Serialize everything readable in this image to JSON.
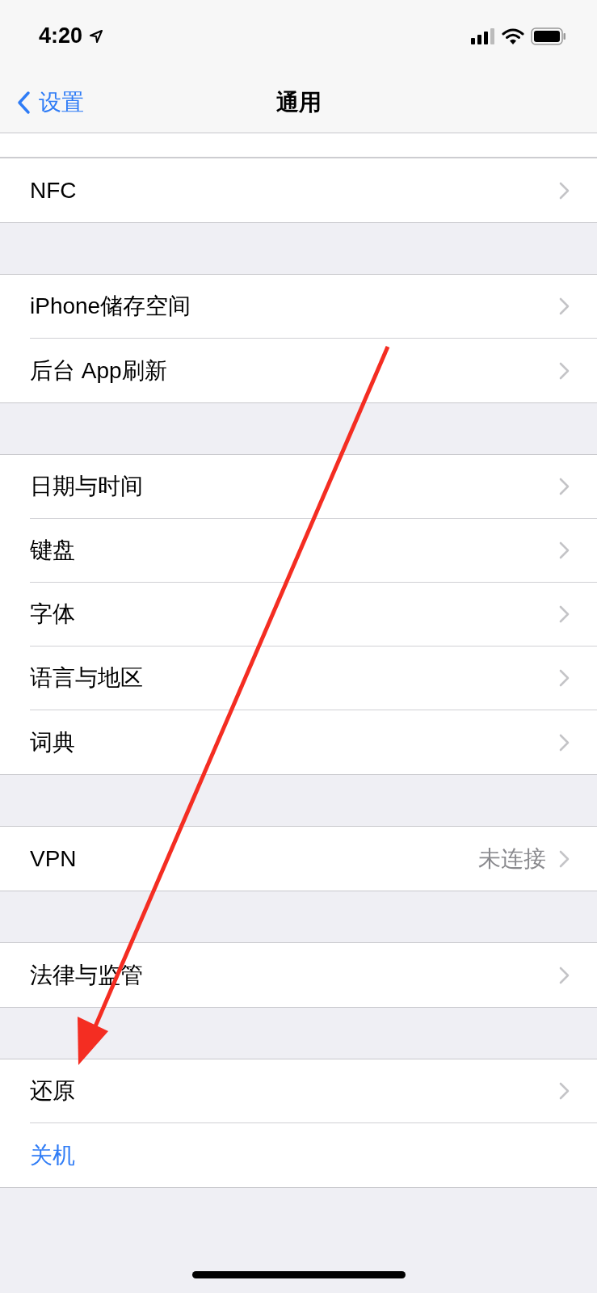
{
  "status_bar": {
    "time": "4:20"
  },
  "nav_bar": {
    "back": "设置",
    "title": "通用"
  },
  "groups": [
    {
      "rows": [
        {
          "label": "NFC",
          "kind": "nav"
        }
      ]
    },
    {
      "rows": [
        {
          "label": "iPhone储存空间",
          "kind": "nav"
        },
        {
          "label": "后台 App刷新",
          "kind": "nav"
        }
      ]
    },
    {
      "rows": [
        {
          "label": "日期与时间",
          "kind": "nav"
        },
        {
          "label": "键盘",
          "kind": "nav"
        },
        {
          "label": "字体",
          "kind": "nav"
        },
        {
          "label": "语言与地区",
          "kind": "nav"
        },
        {
          "label": "词典",
          "kind": "nav"
        }
      ]
    },
    {
      "rows": [
        {
          "label": "VPN",
          "kind": "nav",
          "value": "未连接"
        }
      ]
    },
    {
      "rows": [
        {
          "label": "法律与监管",
          "kind": "nav"
        }
      ]
    },
    {
      "rows": [
        {
          "label": "还原",
          "kind": "nav"
        },
        {
          "label": "关机",
          "kind": "action"
        }
      ]
    }
  ]
}
